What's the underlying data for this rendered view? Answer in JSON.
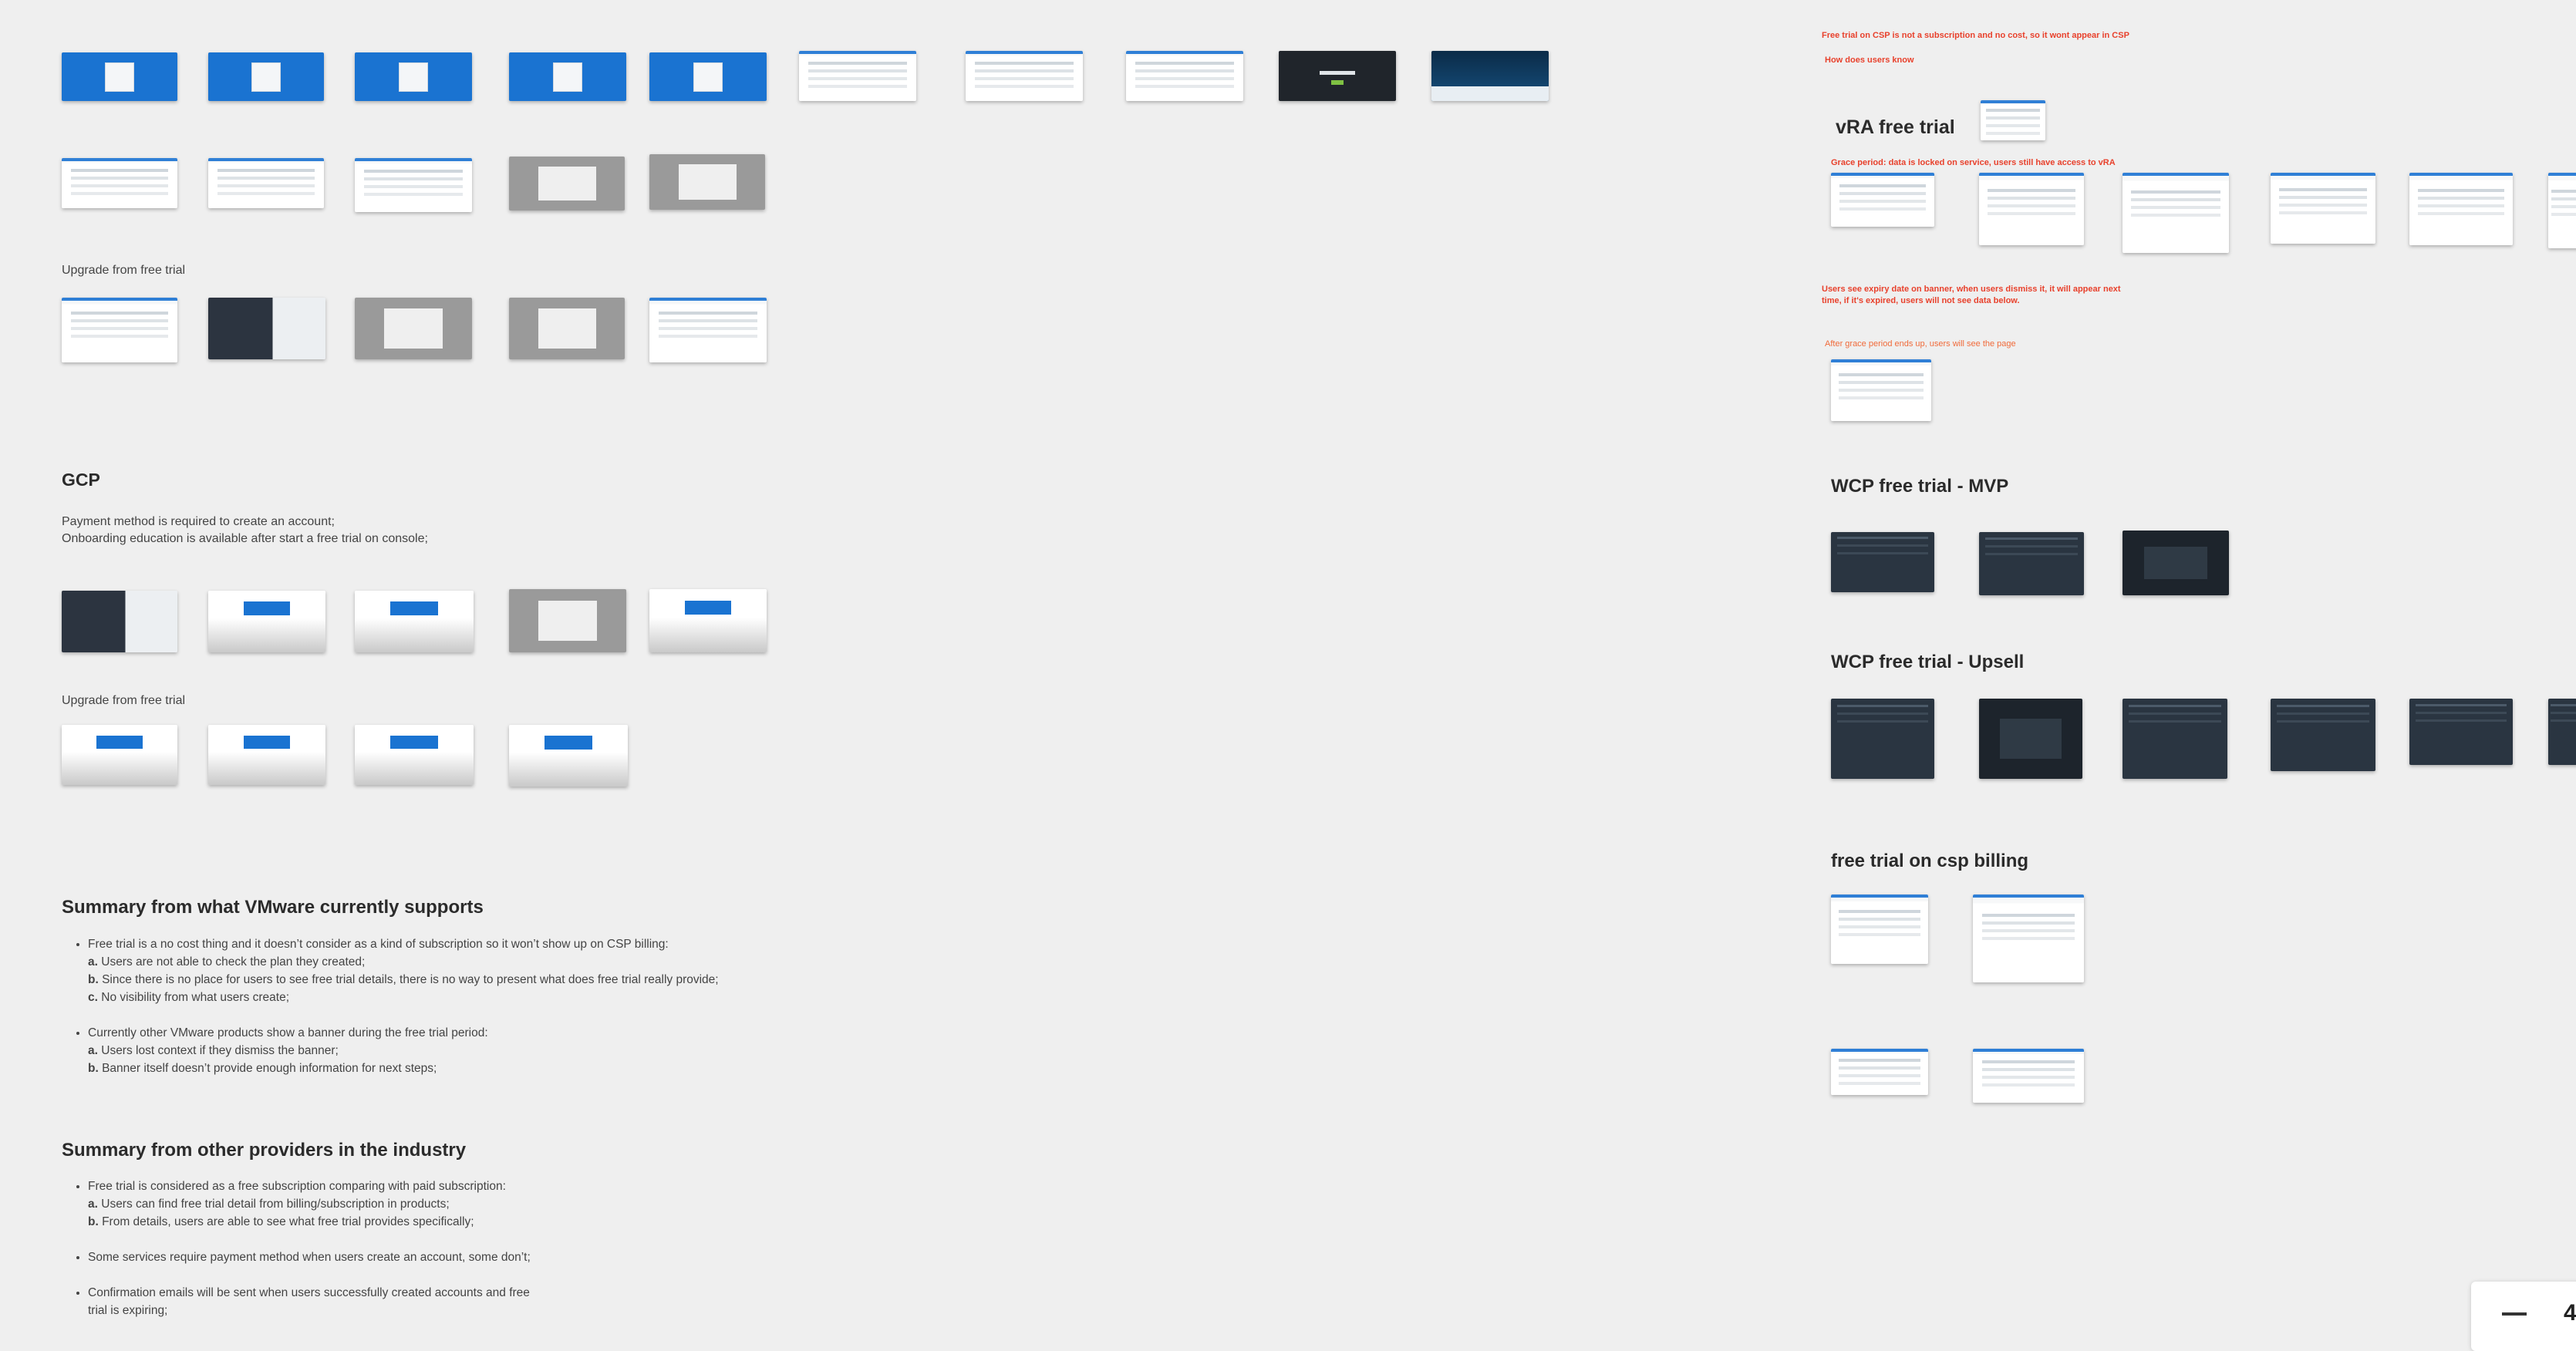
{
  "left": {
    "upgrade_label_1": "Upgrade from free trial",
    "gcp_title": "GCP",
    "gcp_desc_1": "Payment method is required to create an account;",
    "gcp_desc_2": "Onboarding education is available after start a free trial on console;",
    "upgrade_label_2": "Upgrade from free trial",
    "summary_vmware_title": "Summary from what VMware currently supports",
    "summary_vmware": {
      "b1": "Free trial is a no cost thing and it doesn’t consider as a kind of subscription so it won’t show up on CSP billing:",
      "b1a_k": "a.",
      "b1a": " Users are not able to check the plan they created;",
      "b1b_k": "b.",
      "b1b": " Since there is no place for users to see free trial details, there is no way to present what does free trial really provide;",
      "b1c_k": "c.",
      "b1c": " No visibility from what users create;",
      "b2": "Currently other VMware products show a banner during the free trial period:",
      "b2a_k": "a.",
      "b2a": " Users lost context if they dismiss the banner;",
      "b2b_k": "b.",
      "b2b": " Banner itself doesn’t provide enough information for next steps;"
    },
    "summary_other_title": "Summary from other providers in the industry",
    "summary_other": {
      "b1": "Free trial is considered as a free subscription comparing with paid subscription:",
      "b1a_k": "a.",
      "b1a": " Users can find free trial detail from billing/subscription in products;",
      "b1b_k": "b.",
      "b1b": " From details, users are able to see what free trial provides specifically;",
      "b2": "Some services require payment method when users create an account, some don’t;",
      "b3a": "Confirmation emails will be sent when users successfully created accounts and free",
      "b3b": "trial is expiring;"
    }
  },
  "right": {
    "note_csp": "Free trial on CSP is not a subscription and no cost, so it wont appear in CSP",
    "note_how": "How does users know",
    "vra_title": "vRA free trial",
    "note_grace": "Grace period: data is locked on service, users still have access to vRA",
    "note_expiry_1": "Users see expiry date on banner, when users dismiss it, it will appear next",
    "note_expiry_2": "time, if it's expired, users will not see data below.",
    "note_after": "After grace period ends up, users will see the page",
    "wcp_mvp_title": "WCP free trial - MVP",
    "wcp_upsell_title": "WCP free trial - Upsell",
    "csp_billing_title": "free trial on csp billing"
  },
  "zoom": {
    "value": "4"
  },
  "colors": {
    "note_red": "#e8412c",
    "canvas": "#efefef",
    "accent_blue": "#1a73d1"
  }
}
